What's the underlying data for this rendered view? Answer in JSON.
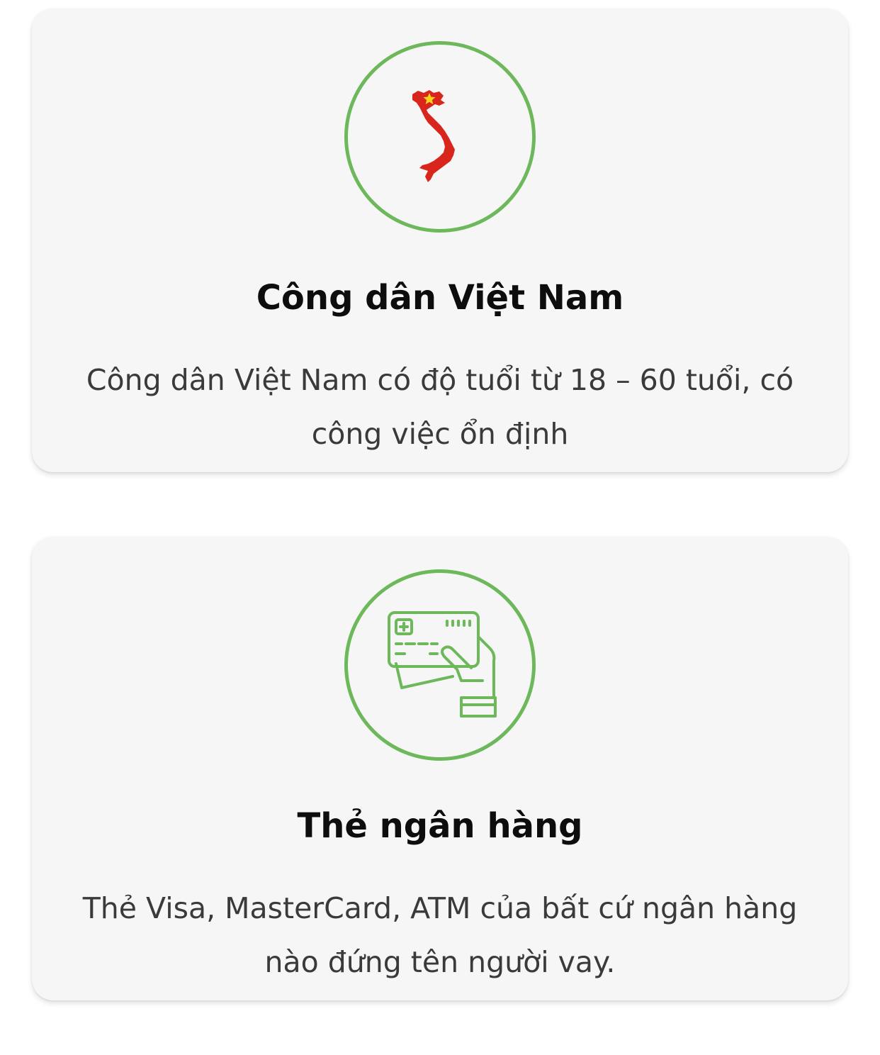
{
  "cards": [
    {
      "icon": "vietnam-map-icon",
      "title": "Công dân Việt Nam",
      "description_lines": [
        "Công dân Việt Nam có độ tuổi từ 18 – 60 tuổi, có",
        "công việc ổn định"
      ]
    },
    {
      "icon": "bank-card-hand-icon",
      "title": "Thẻ ngân hàng",
      "description_lines": [
        "Thẻ Visa, MasterCard, ATM của bất cứ ngân hàng",
        "nào đứng tên người vay."
      ]
    }
  ],
  "colors": {
    "accent_green": "#6cb85a",
    "map_red": "#d9261c",
    "star_yellow": "#f7d21a",
    "card_background": "#f6f6f6",
    "title_text": "#0d0d0d",
    "body_text": "#3a3a3a"
  }
}
